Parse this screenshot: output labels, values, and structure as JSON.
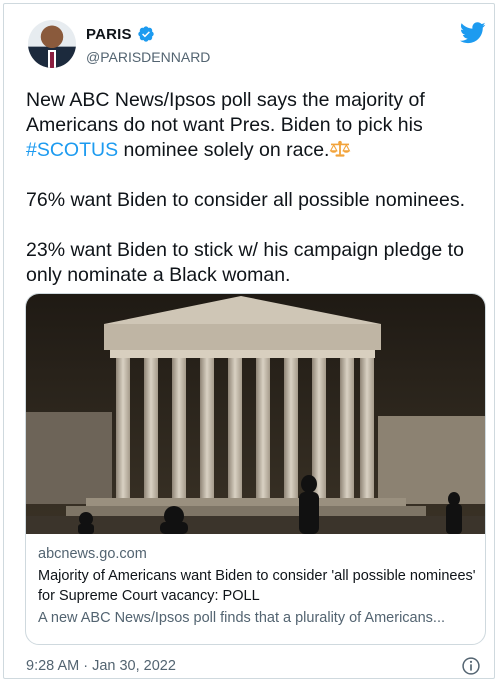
{
  "author": {
    "name": "PARIS",
    "handle": "@PARISDENNARD",
    "verified": true
  },
  "tweet": {
    "line1": "New ABC News/Ipsos poll says the majority of Americans do not want Pres. Biden to pick his ",
    "hashtag": "#SCOTUS",
    "line1_rest": " nominee solely on race.",
    "emoji_icon": "balance-scale-icon",
    "paragraph2": "76% want Biden to consider all possible nominees.",
    "paragraph3": "23% want Biden to stick w/ his campaign pledge to only nominate a Black woman."
  },
  "link_card": {
    "domain": "abcnews.go.com",
    "title": "Majority of Americans want Biden to consider 'all possible nominees' for Supreme Court vacancy: POLL",
    "description": "A new ABC News/Ipsos poll finds that a plurality of Americans...",
    "image": "supreme-court-building-photo"
  },
  "footer": {
    "timestamp": "9:28 AM · Jan 30, 2022",
    "info_icon": "info-icon"
  },
  "colors": {
    "accent": "#1d9bf0",
    "text": "#0f1419",
    "secondary": "#536471",
    "border": "#cfd9de"
  }
}
